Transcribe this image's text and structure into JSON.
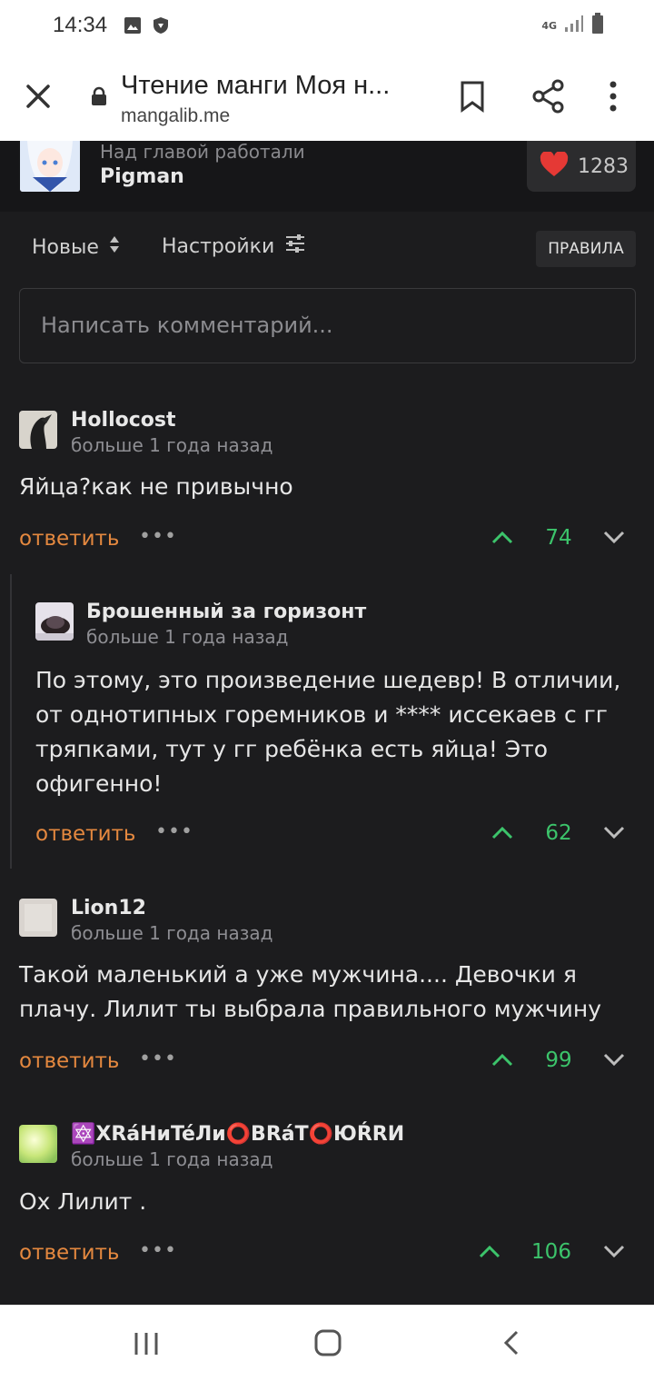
{
  "status_bar": {
    "time": "14:34",
    "network": "4G"
  },
  "browser": {
    "title": "Чтение манги Моя н...",
    "url": "mangalib.me"
  },
  "credits": {
    "label": "Над главой работали",
    "name": "Pigman",
    "likes": "1283"
  },
  "toolbar": {
    "sort_label": "Новые",
    "settings_label": "Настройки",
    "rules_label": "ПРАВИЛА"
  },
  "comment_input": {
    "placeholder": "Написать комментарий..."
  },
  "comments": [
    {
      "user": "Hollocost",
      "time": "больше 1 года назад",
      "text": "Яйца?как не привычно",
      "reply": "ответить",
      "score": "74"
    },
    {
      "user": "Брошенный за горизонт",
      "time": "больше 1 года назад",
      "text": "По этому, это произведение шедевр! В отличии, от однотипных горемников и **** иссекаев с гг тряпками, тут у гг ребёнка есть яйца! Это офигенно!",
      "reply": "ответить",
      "score": "62"
    },
    {
      "user": "Lion12",
      "time": "больше 1 года назад",
      "text": "Такой маленький а уже мужчина.... Девочки я плачу. Лилит ты выбрала правильного мужчину",
      "reply": "ответить",
      "score": "99"
    },
    {
      "user": "🔯XRáHиTéЛи⭕BRáT⭕ЮŔRИ",
      "time": "больше 1 года назад",
      "text": "Ох Лилит .",
      "reply": "ответить",
      "score": "106"
    }
  ],
  "colors": {
    "background": "#1c1c1e",
    "reply": "#e4883f",
    "score": "#3cc46b",
    "like": "#e53935"
  }
}
